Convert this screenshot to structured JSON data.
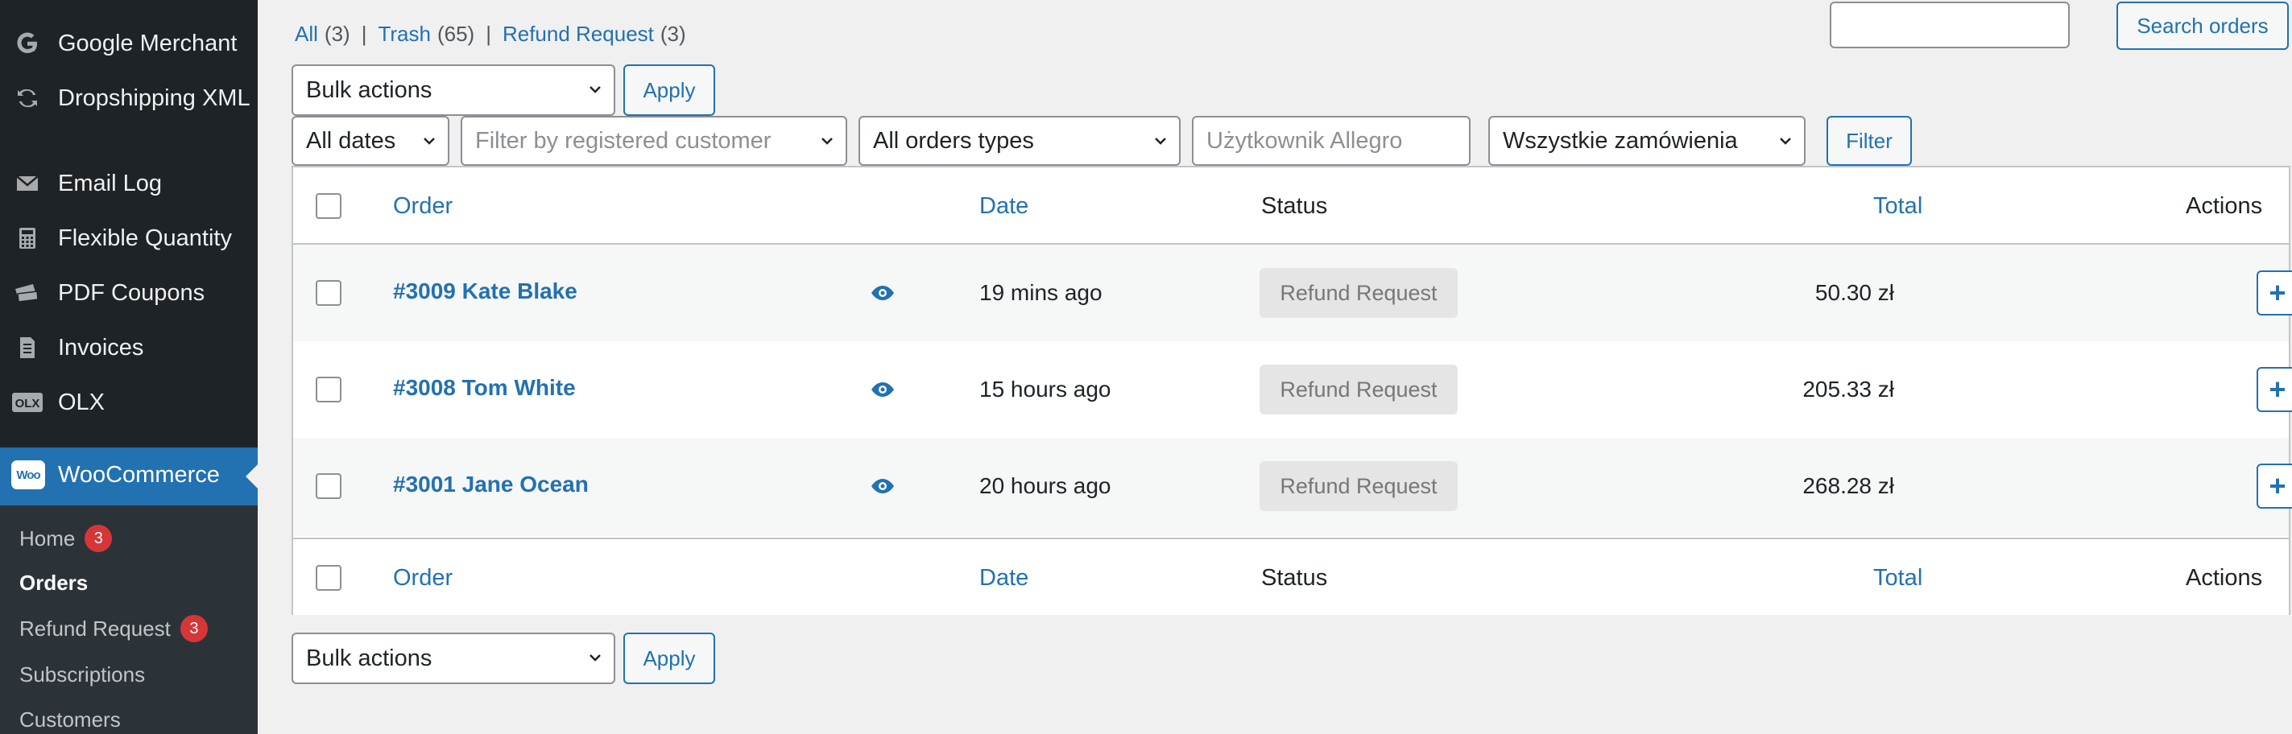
{
  "sidebar": {
    "items": [
      {
        "label": "Google Merchant",
        "icon": "google-icon"
      },
      {
        "label": "Dropshipping XML",
        "icon": "sync-icon"
      },
      {
        "label": "Email Log",
        "icon": "envelope-icon"
      },
      {
        "label": "Flexible Quantity",
        "icon": "calculator-icon"
      },
      {
        "label": "PDF Coupons",
        "icon": "coupons-icon"
      },
      {
        "label": "Invoices",
        "icon": "invoice-icon"
      },
      {
        "label": "OLX",
        "icon": "olx-logo-icon"
      }
    ],
    "woocommerce": {
      "label": "WooCommerce",
      "logo": "Woo"
    },
    "submenu": [
      {
        "label": "Home",
        "badge": "3"
      },
      {
        "label": "Orders",
        "current": true
      },
      {
        "label": "Refund Request",
        "badge": "3"
      },
      {
        "label": "Subscriptions"
      },
      {
        "label": "Customers"
      }
    ]
  },
  "views": {
    "all_label": "All",
    "all_count": "(3)",
    "trash_label": "Trash",
    "trash_count": "(65)",
    "refund_label": "Refund Request",
    "refund_count": "(3)",
    "separator": "|"
  },
  "search": {
    "value": "",
    "button_label": "Search orders"
  },
  "bulk_top": {
    "selected": "Bulk actions",
    "apply_label": "Apply"
  },
  "bulk_bottom": {
    "selected": "Bulk actions",
    "apply_label": "Apply"
  },
  "filters": {
    "dates": "All dates",
    "customer_placeholder": "Filter by registered customer",
    "order_types": "All orders types",
    "allegro_user_placeholder": "Użytkownik Allegro",
    "all_orders": "Wszystkie zamówienia",
    "filter_label": "Filter"
  },
  "table": {
    "columns": {
      "order": "Order",
      "date": "Date",
      "status": "Status",
      "total": "Total",
      "actions": "Actions"
    },
    "rows": [
      {
        "order": "#3009 Kate Blake",
        "date": "19 mins ago",
        "status": "Refund Request",
        "total": "50.30 zł",
        "action": "+"
      },
      {
        "order": "#3008 Tom White",
        "date": "15 hours ago",
        "status": "Refund Request",
        "total": "205.33 zł",
        "action": "+"
      },
      {
        "order": "#3001 Jane Ocean",
        "date": "20 hours ago",
        "status": "Refund Request",
        "total": "268.28 zł",
        "action": "+"
      }
    ]
  },
  "colors": {
    "accent": "#2271b1",
    "sidebar": "#1d2327",
    "badge": "#d63638",
    "status_bg": "#e5e5e5"
  }
}
